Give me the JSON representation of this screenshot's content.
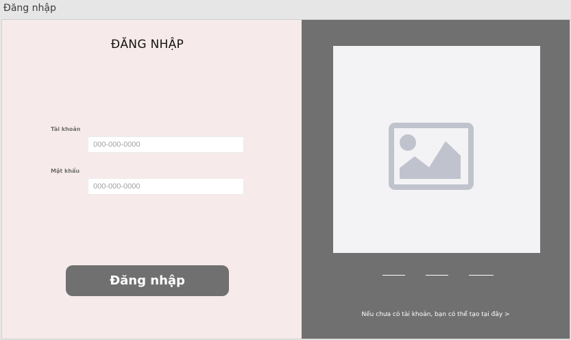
{
  "window": {
    "title": "Đăng nhập"
  },
  "form": {
    "heading": "ĐĂNG NHẬP",
    "username_label": "Tài khoản",
    "username_placeholder": "000-000-0000",
    "password_label": "Mật khẩu",
    "password_placeholder": "000-000-0000",
    "submit_label": "Đăng nhập"
  },
  "side_panel": {
    "image_icon": "image-placeholder-icon",
    "signup_text": "Nếu chưa có tài khoản, bạn có thể tạo tại đây >"
  },
  "colors": {
    "form_background": "#f7eaea",
    "side_panel_background": "#707070",
    "button": "#707070",
    "placeholder_icon": "#c0c3cd"
  }
}
